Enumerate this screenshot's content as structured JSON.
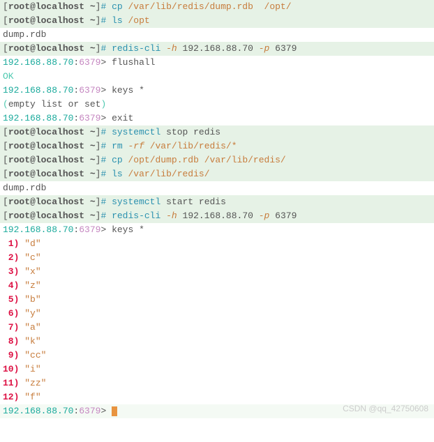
{
  "prompt": {
    "open": "[",
    "text": "root@localhost ~",
    "close": "]",
    "hash": "# "
  },
  "lines": {
    "l1": {
      "cmd": "cp",
      "arg1": "/var/lib/redis/dump.rdb",
      "arg2": "/opt/"
    },
    "l2": {
      "cmd": "ls",
      "arg1": "/opt"
    },
    "l3": {
      "txt": "dump.rdb"
    },
    "l4": {
      "cmd": "redis-cli",
      "flag1": "-h",
      "ip": "192.168.88.70",
      "flag2": "-p",
      "port": "6379"
    },
    "l5": {
      "ip": "192.168.88.70",
      "port": "6379",
      "arr": ">",
      "cmd": "flushall"
    },
    "l6": {
      "txt": "OK"
    },
    "l7": {
      "ip": "192.168.88.70",
      "port": "6379",
      "arr": ">",
      "cmd": "keys *"
    },
    "l8": {
      "p1": "(",
      "txt": "empty list or set",
      "p2": ")"
    },
    "l9": {
      "ip": "192.168.88.70",
      "port": "6379",
      "arr": ">",
      "cmd": "exit"
    },
    "l10": {
      "cmd": "systemctl",
      "arg": "stop redis"
    },
    "l11": {
      "cmd": "rm",
      "flag": "-rf",
      "path": "/var/lib/redis/*"
    },
    "l12": {
      "cmd": "cp",
      "arg1": "/opt/dump.rdb",
      "arg2": "/var/lib/redis/"
    },
    "l13": {
      "cmd": "ls",
      "arg1": "/var/lib/redis/"
    },
    "l14": {
      "txt": "dump.rdb"
    },
    "l15": {
      "cmd": "systemctl",
      "arg": "start redis"
    },
    "l16": {
      "cmd": "redis-cli",
      "flag1": "-h",
      "ip": "192.168.88.70",
      "flag2": "-p",
      "port": "6379"
    },
    "l17": {
      "ip": "192.168.88.70",
      "port": "6379",
      "arr": ">",
      "cmd": "keys *"
    }
  },
  "results": [
    {
      "idx": " 1",
      "val": "\"d\""
    },
    {
      "idx": " 2",
      "val": "\"c\""
    },
    {
      "idx": " 3",
      "val": "\"x\""
    },
    {
      "idx": " 4",
      "val": "\"z\""
    },
    {
      "idx": " 5",
      "val": "\"b\""
    },
    {
      "idx": " 6",
      "val": "\"y\""
    },
    {
      "idx": " 7",
      "val": "\"a\""
    },
    {
      "idx": " 8",
      "val": "\"k\""
    },
    {
      "idx": " 9",
      "val": "\"cc\""
    },
    {
      "idx": "10",
      "val": "\"i\""
    },
    {
      "idx": "11",
      "val": "\"zz\""
    },
    {
      "idx": "12",
      "val": "\"f\""
    }
  ],
  "last": {
    "ip": "192.168.88.70",
    "port": "6379",
    "arr": ">"
  },
  "paren": ")",
  "colon": ":",
  "sp": " ",
  "sp2": "  ",
  "watermark": "CSDN @qq_42750608"
}
